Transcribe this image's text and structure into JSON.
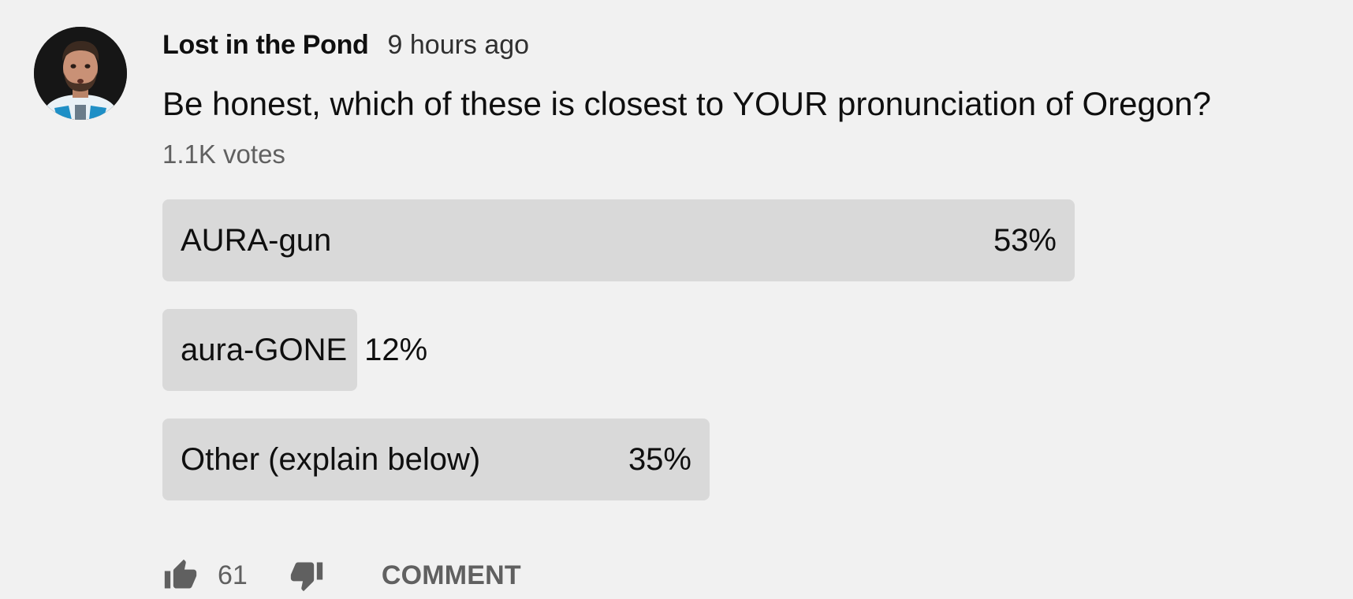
{
  "post": {
    "author": "Lost in the Pond",
    "time": "9 hours ago",
    "question": "Be honest, which of these is closest to YOUR pronunciation of Oregon?",
    "votes": "1.1K votes"
  },
  "poll": {
    "options": [
      {
        "label": "AURA-gun",
        "percent_text": "53%",
        "percent": 53,
        "fill_fraction": 1.0
      },
      {
        "label": "aura-GONE",
        "percent_text": "12%",
        "percent": 12,
        "fill_fraction": 0.2
      },
      {
        "label": "Other (explain below)",
        "percent_text": "35%",
        "percent": 35,
        "fill_fraction": 0.6
      }
    ]
  },
  "actions": {
    "like_count": "61",
    "comment_label": "COMMENT"
  },
  "colors": {
    "background": "#f1f1f1",
    "bar_fill": "#d9d9d9",
    "secondary_text": "#606060"
  }
}
